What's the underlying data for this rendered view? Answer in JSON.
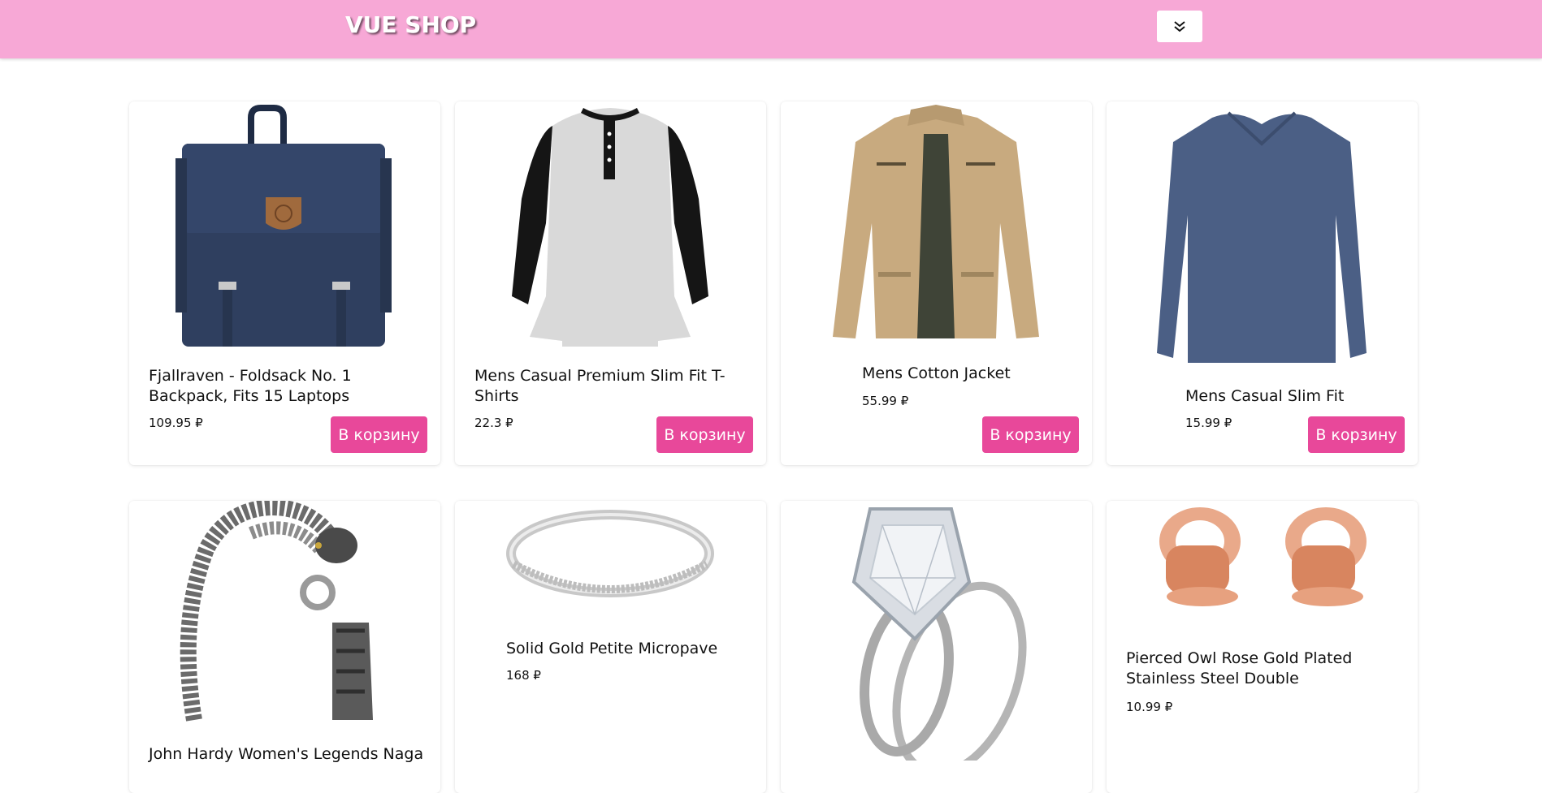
{
  "header": {
    "logo": "VUE SHOP",
    "menu_icon": "double-chevron-down-icon",
    "brand_color": "#f7a8d6"
  },
  "accent_color": "#e8489a",
  "cart_label": "В корзину",
  "products": [
    {
      "title": "Fjallraven - Foldsack No. 1 Backpack, Fits 15 Laptops",
      "price": "109.95 ₽",
      "image": "backpack"
    },
    {
      "title": "Mens Casual Premium Slim Fit T-Shirts",
      "price": "22.3 ₽",
      "image": "henley-tshirt"
    },
    {
      "title": "Mens Cotton Jacket",
      "price": "55.99 ₽",
      "image": "cotton-jacket"
    },
    {
      "title": "Mens Casual Slim Fit",
      "price": "15.99 ₽",
      "image": "longsleeve-shirt"
    },
    {
      "title": "John Hardy Women's Legends Naga",
      "price": "",
      "image": "dragon-bracelet"
    },
    {
      "title": "Solid Gold Petite Micropave",
      "price": "168 ₽",
      "image": "micropave-ring"
    },
    {
      "title": "",
      "price": "",
      "image": "diamond-ring-set"
    },
    {
      "title": "Pierced Owl Rose Gold Plated Stainless Steel Double",
      "price": "10.99 ₽",
      "image": "rose-gold-plugs"
    }
  ]
}
